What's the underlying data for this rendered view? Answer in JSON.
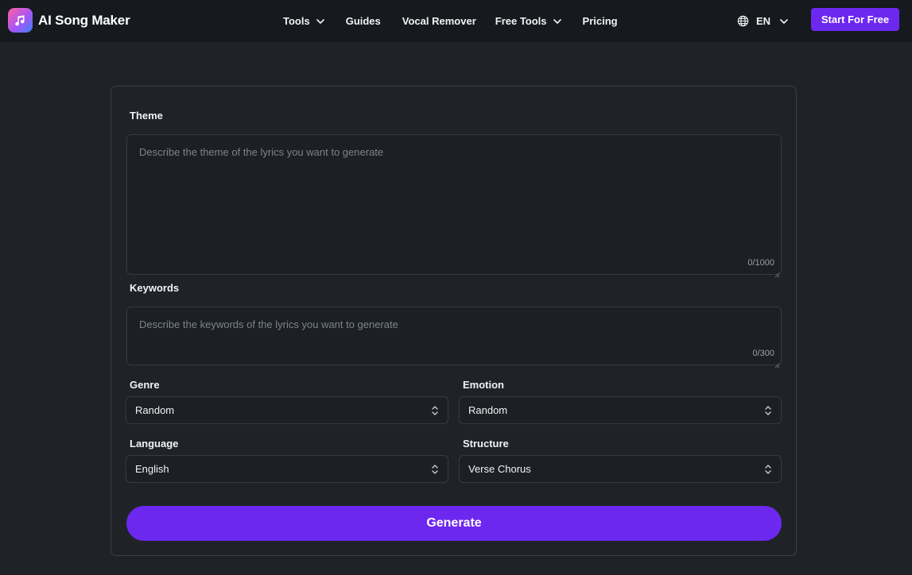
{
  "brand": {
    "name": "AI Song Maker",
    "logo_icon": "music-note-icon"
  },
  "nav": {
    "tools": "Tools",
    "guides": "Guides",
    "vocal_remover": "Vocal Remover",
    "free_tools": "Free Tools",
    "pricing": "Pricing"
  },
  "language": {
    "code": "EN",
    "icon": "globe-icon"
  },
  "cta": {
    "label": "Start For Free"
  },
  "form": {
    "theme": {
      "label": "Theme",
      "placeholder": "Describe the theme of the lyrics you want to generate",
      "counter": "0/1000"
    },
    "keywords": {
      "label": "Keywords",
      "placeholder": "Describe the keywords of the lyrics you want to generate",
      "counter": "0/300"
    },
    "genre": {
      "label": "Genre",
      "value": "Random"
    },
    "emotion": {
      "label": "Emotion",
      "value": "Random"
    },
    "language": {
      "label": "Language",
      "value": "English"
    },
    "structure": {
      "label": "Structure",
      "value": "Verse Chorus"
    },
    "generate_label": "Generate"
  },
  "colors": {
    "accent": "#6d28f0",
    "background": "#1f2328",
    "header": "#16191d"
  }
}
